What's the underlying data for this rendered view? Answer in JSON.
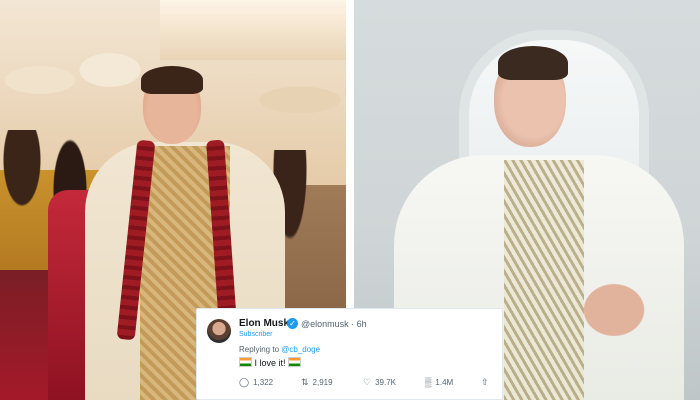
{
  "tweet": {
    "author_name": "Elon Musk",
    "handle_time": "@elonmusk · 6h",
    "badge": "Subscriber",
    "reply_prefix": "Replying to",
    "reply_mention": "@cb_doge",
    "text": "I love it!",
    "stats": {
      "replies": "1,322",
      "retweets": "2,919",
      "likes": "39.7K",
      "views": "1.4M"
    },
    "icons": [
      "verified-icon",
      "reply-icon",
      "retweet-icon",
      "like-icon",
      "views-icon",
      "share-icon"
    ],
    "colors": {
      "accent": "#1d9bf0",
      "text": "#14171a",
      "muted": "#536471"
    }
  }
}
